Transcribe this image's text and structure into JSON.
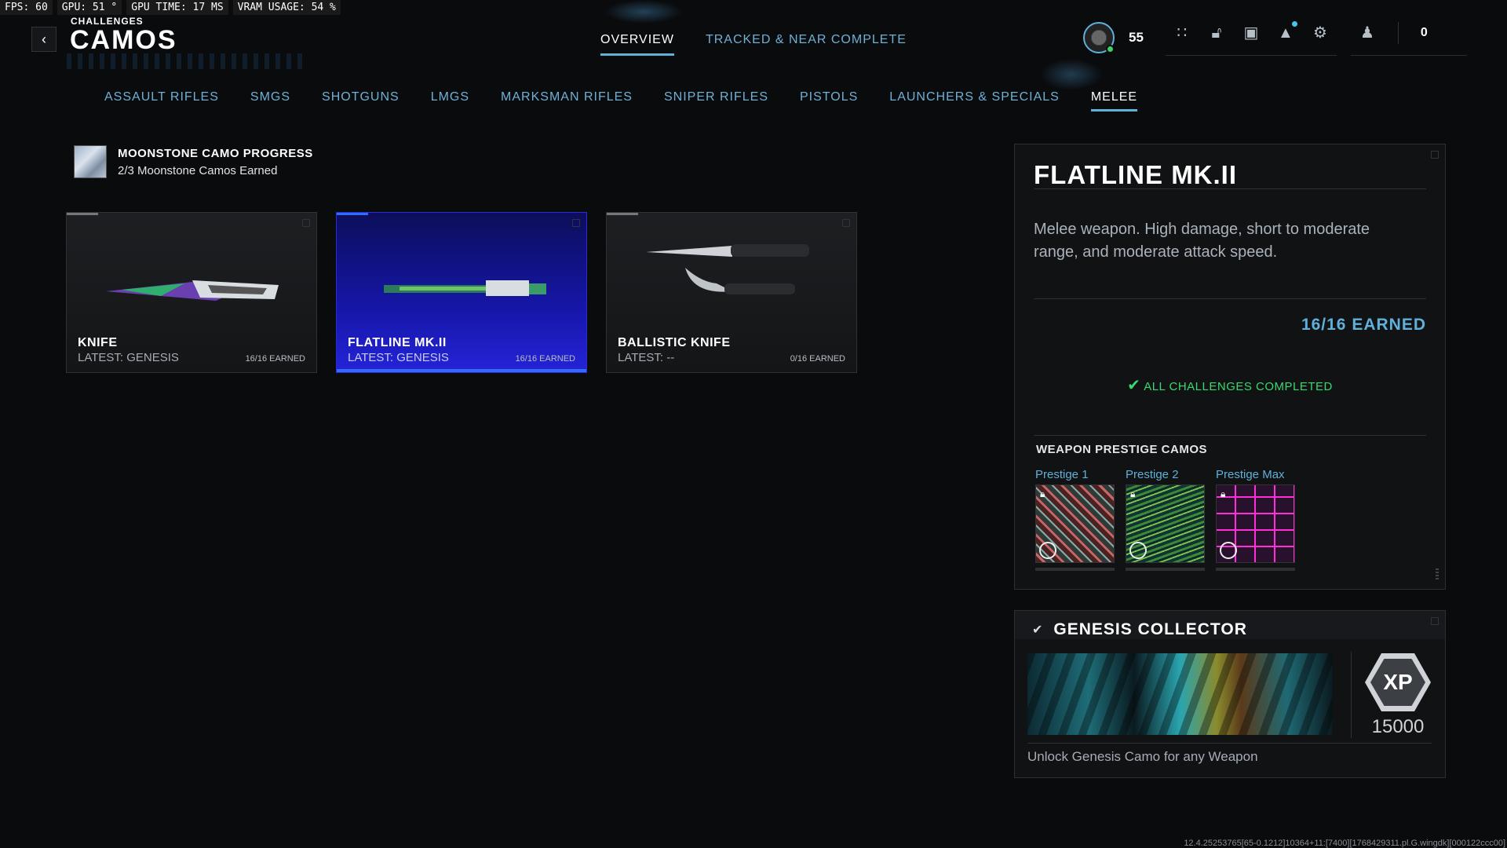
{
  "perf": {
    "fps": "FPS:  60",
    "gpu": "GPU: 51 °",
    "gpu_time": "GPU TIME: 17 MS",
    "vram": "VRAM USAGE: 54 %"
  },
  "header": {
    "breadcrumb": "CHALLENGES",
    "title": "CAMOS",
    "back_icon": "chevron-left-icon"
  },
  "top_tabs": [
    {
      "label": "OVERVIEW",
      "active": true
    },
    {
      "label": "TRACKED & NEAR COMPLETE",
      "active": false
    }
  ],
  "hud": {
    "level": "55",
    "count": "0",
    "icons": [
      "grid-icon",
      "lock-open-icon",
      "camera-icon",
      "bell-icon",
      "gear-icon"
    ],
    "friends_icon": "friends-icon"
  },
  "categories": [
    {
      "label": "ASSAULT RIFLES",
      "active": false
    },
    {
      "label": "SMGS",
      "active": false
    },
    {
      "label": "SHOTGUNS",
      "active": false
    },
    {
      "label": "LMGS",
      "active": false
    },
    {
      "label": "MARKSMAN RIFLES",
      "active": false
    },
    {
      "label": "SNIPER RIFLES",
      "active": false
    },
    {
      "label": "PISTOLS",
      "active": false
    },
    {
      "label": "LAUNCHERS & SPECIALS",
      "active": false
    },
    {
      "label": "MELEE",
      "active": true
    }
  ],
  "moonstone": {
    "title": "MOONSTONE CAMO PROGRESS",
    "subtitle": "2/3 Moonstone Camos Earned"
  },
  "weapons": [
    {
      "name": "KNIFE",
      "latest": "LATEST: GENESIS",
      "earned": "16/16 EARNED",
      "selected": false
    },
    {
      "name": "FLATLINE MK.II",
      "latest": "LATEST: GENESIS",
      "earned": "16/16 EARNED",
      "selected": true
    },
    {
      "name": "BALLISTIC KNIFE",
      "latest": "LATEST: --",
      "earned": "0/16 EARNED",
      "selected": false
    }
  ],
  "detail": {
    "title": "FLATLINE MK.II",
    "description": "Melee weapon. High damage, short to moderate range, and moderate attack speed.",
    "earned": "16/16 EARNED",
    "status": "ALL CHALLENGES COMPLETED",
    "prestige_header": "WEAPON PRESTIGE CAMOS",
    "prestige": [
      {
        "label": "Prestige 1"
      },
      {
        "label": "Prestige 2"
      },
      {
        "label": "Prestige Max"
      }
    ]
  },
  "reward": {
    "title": "GENESIS COLLECTOR",
    "xp_label": "XP",
    "xp_value": "15000",
    "description": "Unlock Genesis Camo for any Weapon"
  },
  "build": "12.4.25253765[65-0.1212]10364+11:[7400][1768429311.pl.G.wingdk][000122ccc00]"
}
